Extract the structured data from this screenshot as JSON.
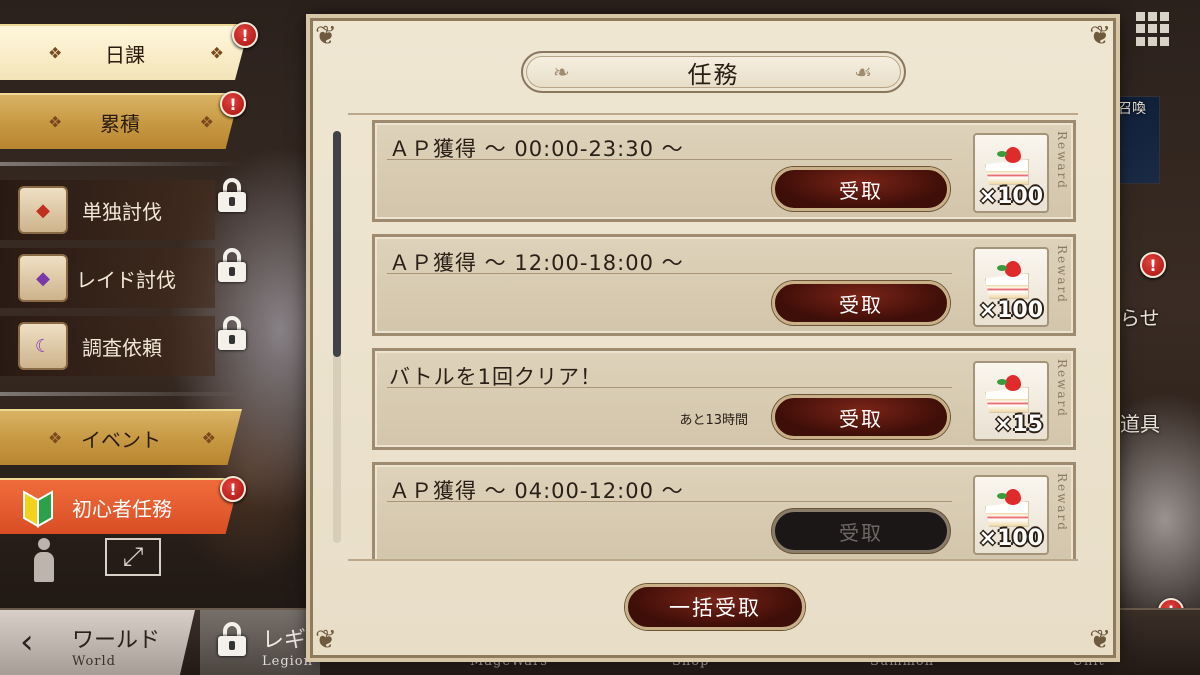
{
  "left_menu": {
    "daily": "日課",
    "cumulative": "累積",
    "solo": "単独討伐",
    "raid": "レイド討伐",
    "investigation": "調査依頼",
    "event": "イベント",
    "beginner": "初心者任務",
    "badge": "!"
  },
  "dialog": {
    "title": "任務",
    "reward_label": "Reward",
    "claim_all": "一括受取",
    "missions": [
      {
        "title": "ＡＰ獲得 〜 00:00-23:30 〜",
        "remain": "",
        "button": "受取",
        "reward_qty": "×100",
        "claimable": true
      },
      {
        "title": "ＡＰ獲得 〜 12:00-18:00 〜",
        "remain": "",
        "button": "受取",
        "reward_qty": "×100",
        "claimable": true
      },
      {
        "title": "バトルを1回クリア！",
        "remain": "あと13時間",
        "button": "受取",
        "reward_qty": "×15",
        "claimable": true
      },
      {
        "title": "ＡＰ獲得 〜 04:00-12:00 〜",
        "remain": "",
        "button": "受取",
        "reward_qty": "×100",
        "claimable": false
      }
    ]
  },
  "bottom_nav": {
    "world_jp": "ワールド",
    "world_en": "World",
    "legion_jp": "レギ",
    "legion_en": "Legion",
    "magewars_en": "MageWars",
    "shop_en": "Shop",
    "summon_en": "Summon",
    "unit_en": "Unit"
  },
  "background": {
    "summon_text": "召喚",
    "notice_text": "らせ",
    "item_text": "道具"
  }
}
